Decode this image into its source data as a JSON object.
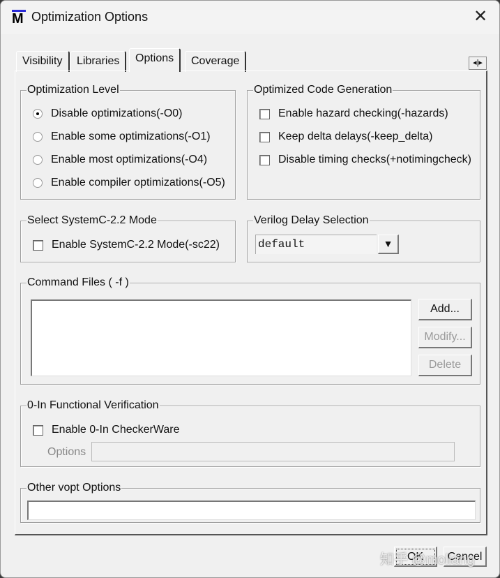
{
  "window": {
    "title": "Optimization Options",
    "logo_letter": "M"
  },
  "tabs": [
    {
      "label": "Visibility"
    },
    {
      "label": "Libraries"
    },
    {
      "label": "Options",
      "active": true
    },
    {
      "label": "Coverage"
    }
  ],
  "tab_scroll": {
    "left": "◂",
    "right": "▸"
  },
  "optimization_level": {
    "title": "Optimization Level",
    "options": [
      {
        "label": "Disable optimizations(-O0)",
        "selected": true
      },
      {
        "label": "Enable some optimizations(-O1)",
        "selected": false
      },
      {
        "label": "Enable most optimizations(-O4)",
        "selected": false
      },
      {
        "label": "Enable compiler optimizations(-O5)",
        "selected": false
      }
    ]
  },
  "code_generation": {
    "title": "Optimized Code Generation",
    "options": [
      {
        "label": "Enable hazard checking(-hazards)",
        "checked": false
      },
      {
        "label": "Keep delta delays(-keep_delta)",
        "checked": false
      },
      {
        "label": "Disable timing checks(+notimingcheck)",
        "checked": false
      }
    ]
  },
  "systemc": {
    "title": "Select SystemC-2.2 Mode",
    "option": {
      "label": "Enable SystemC-2.2 Mode(-sc22)",
      "checked": false
    }
  },
  "verilog_delay": {
    "title": "Verilog Delay Selection",
    "selected": "default"
  },
  "command_files": {
    "title": "Command Files ( -f )",
    "items": [],
    "add": "Add...",
    "modify": "Modify...",
    "delete": "Delete"
  },
  "zero_in": {
    "title": "0-In Functional Verification",
    "option": {
      "label": "Enable 0-In CheckerWare",
      "checked": false
    },
    "options_label": "Options",
    "options_value": ""
  },
  "other_vopt": {
    "title": "Other vopt Options",
    "value": ""
  },
  "footer": {
    "ok": "OK",
    "cancel": "Cancel"
  },
  "watermark": "知乎 @moliang"
}
